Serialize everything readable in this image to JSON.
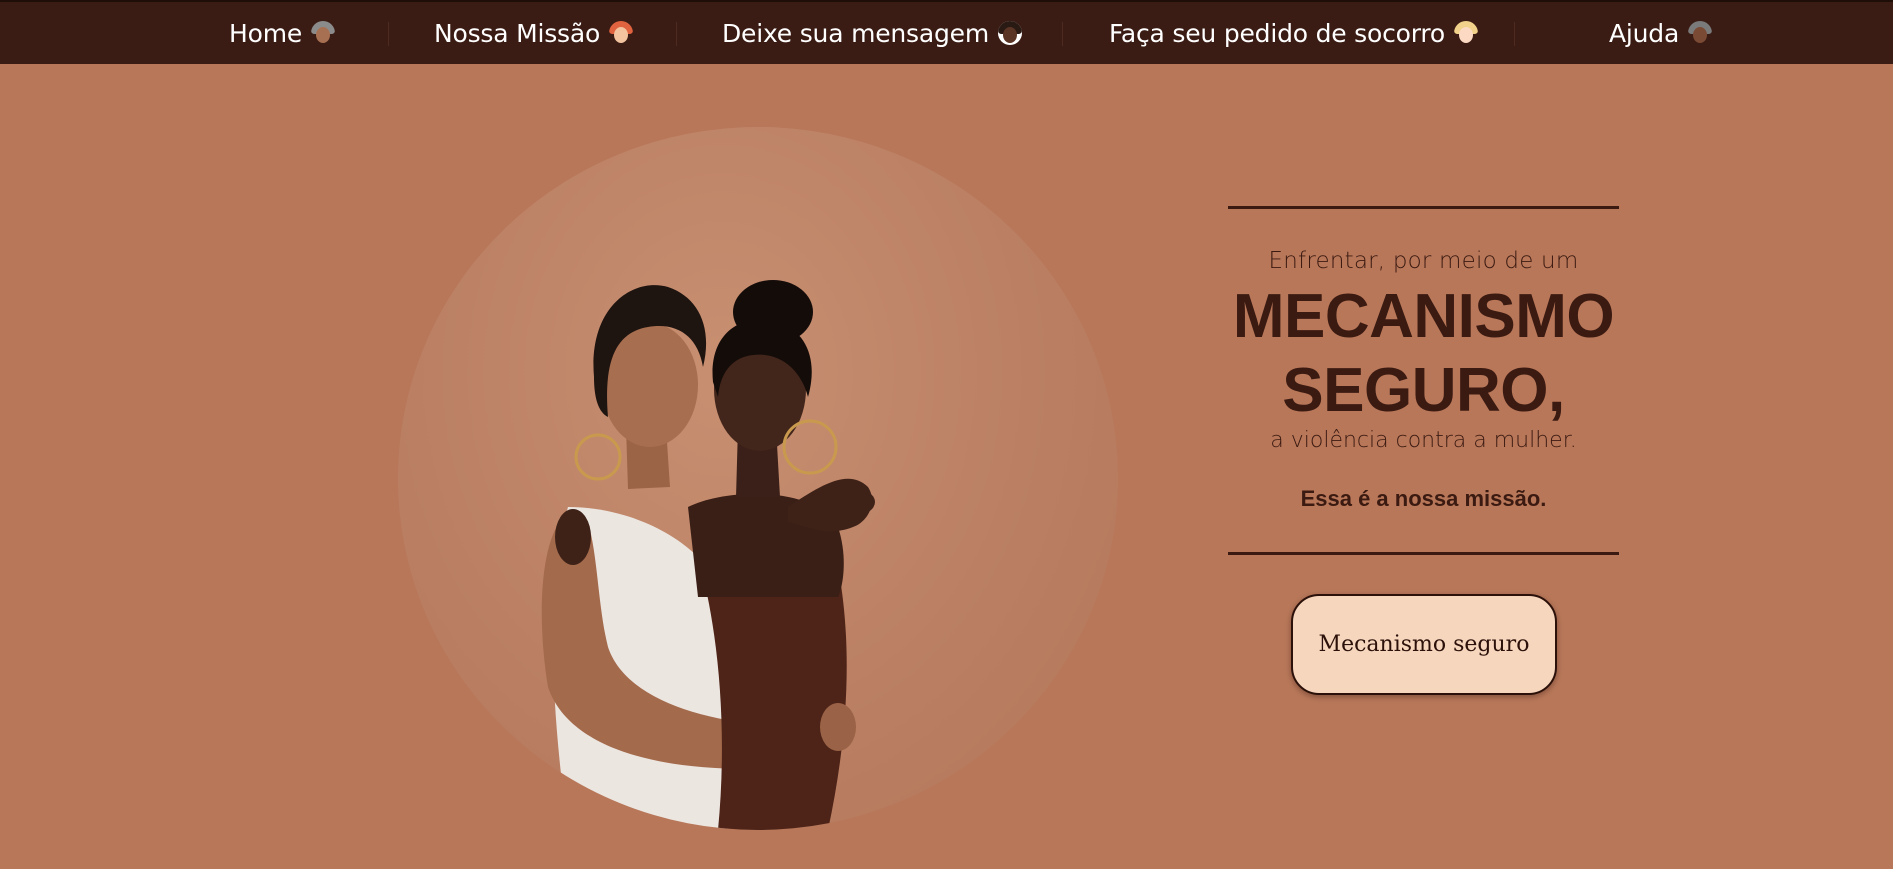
{
  "nav": {
    "items": [
      {
        "label": "Home",
        "emoji": "woman-gray-hair-emoji-icon"
      },
      {
        "label": "Nossa Missão",
        "emoji": "woman-red-hair-emoji-icon"
      },
      {
        "label": "Deixe sua mensagem",
        "emoji": "woman-curly-hair-emoji-icon"
      },
      {
        "label": "Faça seu pedido de socorro",
        "emoji": "woman-blond-emoji-icon"
      },
      {
        "label": "Ajuda",
        "emoji": "woman-dark-gray-hair-emoji-icon"
      }
    ]
  },
  "hero": {
    "eyebrow": "Enfrentar, por meio de um",
    "headline_line1": "MECANISMO",
    "headline_line2": "SEGURO,",
    "subline": "a violência contra a mulher.",
    "mission": "Essa é a nossa missão.",
    "cta_label": "Mecanismo seguro",
    "photo": "two-women-embracing-photo"
  },
  "colors": {
    "background": "#b87759",
    "navbar": "#3a1c14",
    "text_dark": "#3b1a11",
    "button_bg": "#f7d6be",
    "nav_text": "#ffffff"
  }
}
